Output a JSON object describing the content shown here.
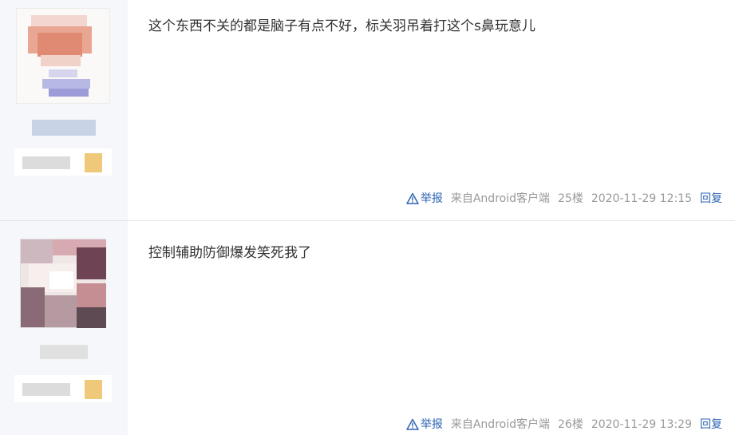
{
  "posts": [
    {
      "content": "这个东西不关的都是脑子有点不好，标关羽吊着打这个s鼻玩意儿",
      "report_label": "举报",
      "source": "来自Android客户端",
      "floor": "25楼",
      "time": "2020-11-29 12:15",
      "reply_label": "回复"
    },
    {
      "content": "控制辅助防御爆发笑死我了",
      "report_label": "举报",
      "source": "来自Android客户端",
      "floor": "26楼",
      "time": "2020-11-29 13:29",
      "reply_label": "回复"
    }
  ],
  "icons": {
    "report": "warning-triangle-icon"
  },
  "colors": {
    "link": "#2d64b3",
    "meta": "#999999",
    "sidebar_bg": "#f6f7fb",
    "text": "#333333"
  }
}
